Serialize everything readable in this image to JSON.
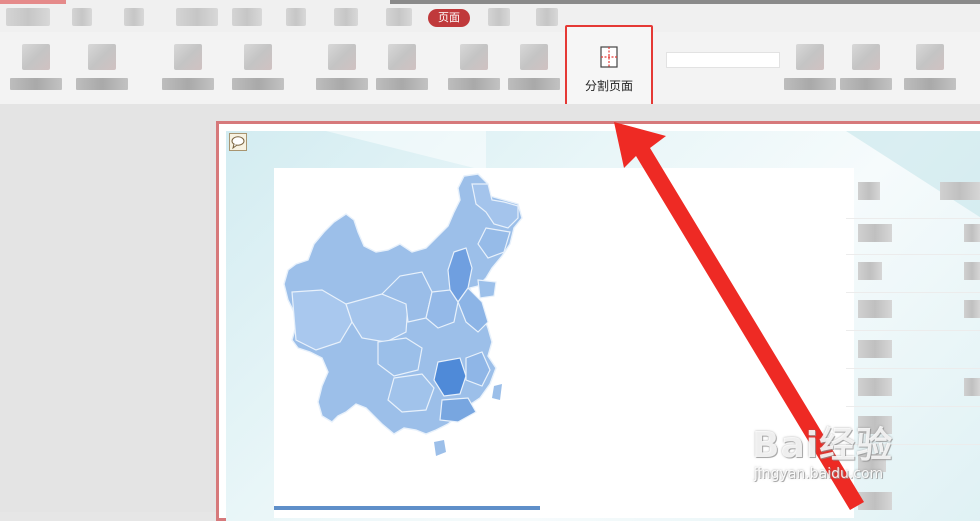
{
  "tabs": {
    "active_label": "页面"
  },
  "ribbon": {
    "split_page_label": "分割页面",
    "split_page_icon": "split-page-icon"
  },
  "slide": {
    "comment_icon": "comment-icon",
    "map_icon": "china-map"
  },
  "annotation": {
    "highlight_color": "#e53935",
    "arrow_color": "#ee2a24"
  },
  "watermark": {
    "brand": "Bai经验",
    "url": "jingyan.baidu.com"
  },
  "colors": {
    "accent": "#c0393b",
    "map_base": "#9cbfe9",
    "map_dark": "#4f8ad8"
  }
}
